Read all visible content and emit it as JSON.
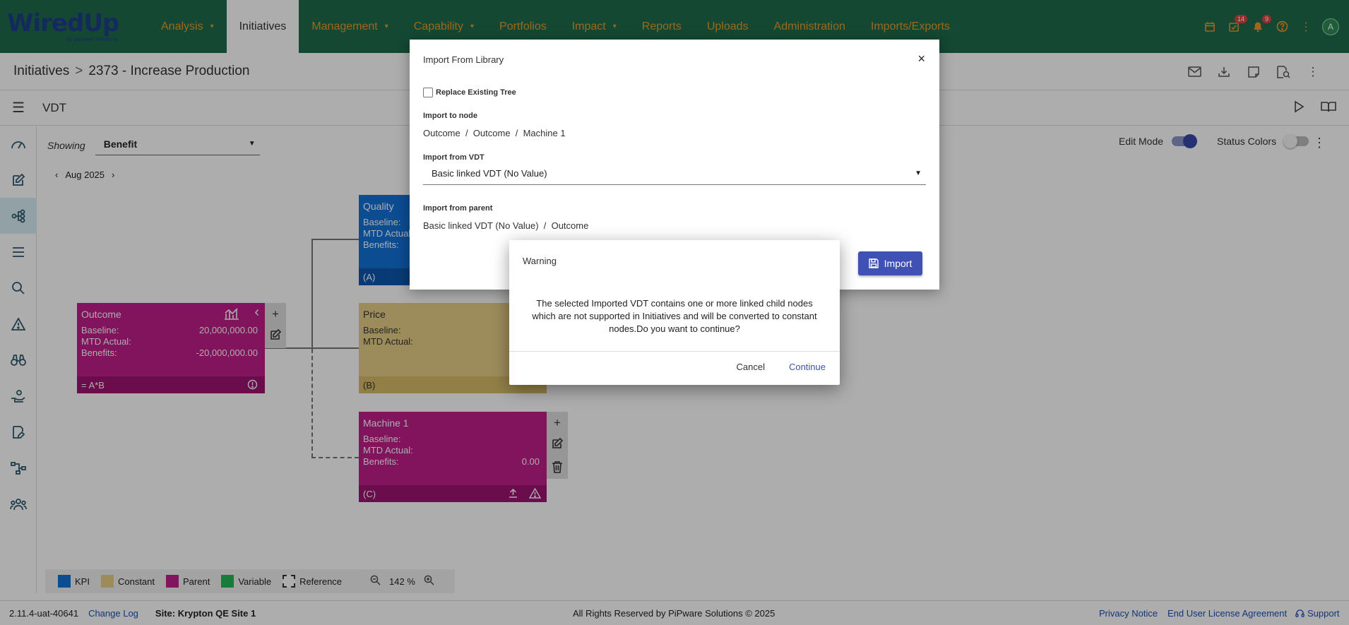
{
  "app": {
    "logo_text": "WiredUp",
    "logo_tagline": "by pipware solutions"
  },
  "nav": {
    "items": [
      {
        "label": "Analysis",
        "caret": "▾"
      },
      {
        "label": "Initiatives",
        "caret": ""
      },
      {
        "label": "Management",
        "caret": "▾"
      },
      {
        "label": "Capability",
        "caret": "▾"
      },
      {
        "label": "Portfolios",
        "caret": ""
      },
      {
        "label": "Impact",
        "caret": "▾"
      },
      {
        "label": "Reports",
        "caret": ""
      },
      {
        "label": "Uploads",
        "caret": ""
      },
      {
        "label": "Administration",
        "caret": ""
      },
      {
        "label": "Imports/Exports",
        "caret": ""
      }
    ],
    "active": "Initiatives",
    "badges": {
      "tasks": "14",
      "notifications": "9"
    },
    "avatar_initial": "A"
  },
  "breadcrumb": {
    "root": "Initiatives",
    "separator": ">",
    "current": "2373 - Increase Production"
  },
  "vdt": {
    "title": "VDT"
  },
  "toolbar": {
    "showing_label": "Showing",
    "showing_value": "Benefit",
    "month": "Aug 2025",
    "edit_mode_label": "Edit Mode",
    "edit_mode_on": true,
    "status_colors_label": "Status Colors",
    "status_colors_on": false
  },
  "nodes": {
    "outcome": {
      "title": "Outcome",
      "baseline_label": "Baseline:",
      "baseline": "20,000,000.00",
      "mtd_label": "MTD Actual:",
      "mtd": "",
      "benefits_label": "Benefits:",
      "benefits": "-20,000,000.00",
      "footer": "= A*B"
    },
    "quality": {
      "title": "Quality",
      "baseline_label": "Baseline:",
      "mtd_label": "MTD Actual:",
      "benefits_label": "Benefits:",
      "footer": "(A)"
    },
    "price": {
      "title": "Price",
      "baseline_label": "Baseline:",
      "mtd_label": "MTD Actual:",
      "footer": "(B)"
    },
    "machine1": {
      "title": "Machine 1",
      "baseline_label": "Baseline:",
      "mtd_label": "MTD Actual:",
      "benefits_label": "Benefits:",
      "benefits": "0.00",
      "footer": "(C)"
    }
  },
  "legend": {
    "items": [
      {
        "label": "KPI",
        "color": "#1370d6"
      },
      {
        "label": "Constant",
        "color": "#e6cf87"
      },
      {
        "label": "Parent",
        "color": "#c01c8a"
      },
      {
        "label": "Variable",
        "color": "#1db954"
      },
      {
        "label": "Reference",
        "color": "#ffffff"
      }
    ],
    "zoom": "142 %"
  },
  "footer": {
    "version": "2.11.4-uat-40641",
    "changelog": "Change Log",
    "site": "Site: Krypton QE Site 1",
    "copyright": "All Rights Reserved by PiPware Solutions © 2025",
    "privacy": "Privacy Notice",
    "eula": "End User License Agreement",
    "support": "Support"
  },
  "import_dialog": {
    "title": "Import From Library",
    "close": "×",
    "replace_label": "Replace Existing Tree",
    "import_to_label": "Import to node",
    "import_to_value": "Outcome  /  Outcome  /  Machine 1",
    "import_from_vdt_label": "Import from VDT",
    "import_from_vdt_value": "Basic linked VDT (No Value)",
    "import_from_parent_label": "Import from parent",
    "import_from_parent_value": "Basic linked VDT (No Value)  /  Outcome",
    "import_button": "Import"
  },
  "warning_dialog": {
    "title": "Warning",
    "message": "The selected Imported VDT contains one or more linked child nodes which are not supported in Initiatives and will be converted to constant nodes.Do you want to continue?",
    "cancel": "Cancel",
    "continue": "Continue"
  }
}
